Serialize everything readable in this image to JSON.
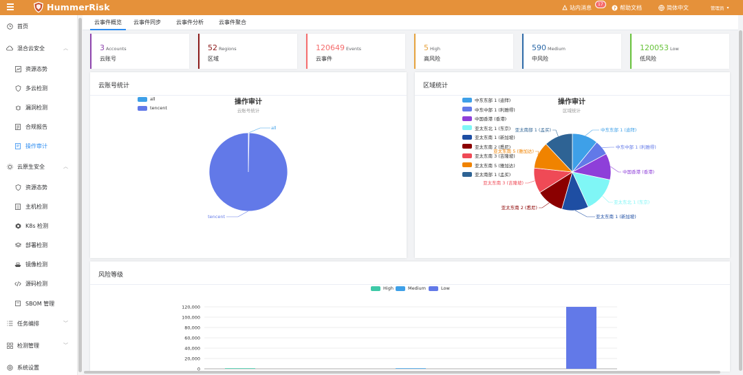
{
  "app": {
    "name": "HummerRisk",
    "brand_color": "#e5913a",
    "accent": "#2d8cf0"
  },
  "topbar": {
    "messages": "站内消息",
    "message_count": "17",
    "help": "帮助文档",
    "language": "简体中文",
    "user": "管理员"
  },
  "sidebar": {
    "items": [
      {
        "label": "首页",
        "icon": "clock-icon"
      },
      {
        "label": "混合云安全",
        "icon": "cloud-icon",
        "expandable": true
      },
      {
        "label": "资源态势",
        "icon": "chart-icon"
      },
      {
        "label": "多云检测",
        "icon": "shield-icon"
      },
      {
        "label": "漏洞检测",
        "icon": "bug-icon"
      },
      {
        "label": "合规报告",
        "icon": "report-icon"
      },
      {
        "label": "操作审计",
        "icon": "audit-icon",
        "active": true
      },
      {
        "label": "云原生安全",
        "icon": "gear-icon",
        "expandable": true
      },
      {
        "label": "资源态势",
        "icon": "shield-icon"
      },
      {
        "label": "主机检测",
        "icon": "list-icon"
      },
      {
        "label": "K8s 检测",
        "icon": "k8s-icon"
      },
      {
        "label": "部署检测",
        "icon": "layers-icon"
      },
      {
        "label": "镜像检测",
        "icon": "ship-icon"
      },
      {
        "label": "源码检测",
        "icon": "code-icon"
      },
      {
        "label": "SBOM 管理",
        "icon": "box-icon"
      },
      {
        "label": "任务编排",
        "icon": "list-icon",
        "expandable": true
      },
      {
        "label": "检测管理",
        "icon": "grid-icon",
        "expandable": true
      },
      {
        "label": "系统设置",
        "icon": "settings-icon"
      }
    ]
  },
  "tabs": [
    {
      "label": "云事件概览",
      "active": true
    },
    {
      "label": "云事件同步"
    },
    {
      "label": "云事件分析"
    },
    {
      "label": "云事件聚合"
    }
  ],
  "stats": [
    {
      "value": "3",
      "unit": "Accounts",
      "label": "云账号",
      "color": "#8e44ad"
    },
    {
      "value": "52",
      "unit": "Regions",
      "label": "区域",
      "color": "#8b1a1a"
    },
    {
      "value": "120649",
      "unit": "Events",
      "label": "云事件",
      "color": "#f56c6c"
    },
    {
      "value": "5",
      "unit": "High",
      "label": "高风险",
      "color": "#e6a23c"
    },
    {
      "value": "590",
      "unit": "Medium",
      "label": "中风险",
      "color": "#2d6aa8"
    },
    {
      "value": "120053",
      "unit": "Low",
      "label": "低风险",
      "color": "#67c23a"
    }
  ],
  "account_chart": {
    "card_title": "云账号统计",
    "title": "操作审计",
    "subtitle": "云账号统计",
    "legend": [
      {
        "name": "all",
        "color": "#3ea0e8"
      },
      {
        "name": "tencent",
        "color": "#6279e8"
      }
    ],
    "chart_data": {
      "type": "pie",
      "labels": [
        "all",
        "tencent"
      ],
      "values": [
        0.3,
        99.7
      ],
      "colors": [
        "#3ea0e8",
        "#6279e8"
      ]
    }
  },
  "region_chart": {
    "card_title": "区域统计",
    "title": "操作审计",
    "subtitle": "区域统计",
    "legend": [
      {
        "name": "中东东部 1 (迪拜)",
        "color": "#3ea0e8"
      },
      {
        "name": "中东中部 1 (利雅得)",
        "color": "#6279e8"
      },
      {
        "name": "中国香港 (香港)",
        "color": "#8e3fd9"
      },
      {
        "name": "亚太东北 1 (东京)",
        "color": "#7ff6f6"
      },
      {
        "name": "亚太东南 1 (新加坡)",
        "color": "#1e4ea3"
      },
      {
        "name": "亚太东南 2 (悉尼)",
        "color": "#8b0000"
      },
      {
        "name": "亚太东南 3 (吉隆坡)",
        "color": "#ef4a56"
      },
      {
        "name": "亚太东南 5 (雅加达)",
        "color": "#f08300"
      },
      {
        "name": "亚太南部 1 (孟买)",
        "color": "#2e6394"
      }
    ],
    "chart_data": {
      "type": "pie",
      "labels": [
        "中东东部 1 (迪拜)",
        "中东中部 1 (利雅得)",
        "中国香港 (香港)",
        "亚太东北 1 (东京)",
        "亚太东南 1 (新加坡)",
        "亚太东南 2 (悉尼)",
        "亚太东南 3 (吉隆坡)",
        "亚太东南 5 (雅加达)",
        "亚太南部 1 (孟买)"
      ],
      "values": [
        10.8,
        6.2,
        11.0,
        14.8,
        11.1,
        11.5,
        10.5,
        11.2,
        11.9
      ],
      "colors": [
        "#3ea0e8",
        "#6279e8",
        "#8e3fd9",
        "#7ff6f6",
        "#1e4ea3",
        "#8b0000",
        "#ef4a56",
        "#f08300",
        "#2e6394"
      ]
    }
  },
  "risk_chart": {
    "card_title": "风险等级",
    "legend": [
      {
        "name": "High",
        "color": "#3ec9a7"
      },
      {
        "name": "Medium",
        "color": "#3ea0e8"
      },
      {
        "name": "Low",
        "color": "#6279e8"
      }
    ],
    "chart_data": {
      "type": "bar",
      "categories": [
        "High",
        "Medium",
        "Low"
      ],
      "series": [
        {
          "name": "High",
          "values": [
            5,
            0,
            0
          ]
        },
        {
          "name": "Medium",
          "values": [
            0,
            590,
            0
          ]
        },
        {
          "name": "Low",
          "values": [
            0,
            0,
            120053
          ]
        }
      ],
      "ylim": [
        0,
        120000
      ],
      "yticks": [
        "0",
        "20,000",
        "40,000",
        "60,000",
        "80,000",
        "100,000",
        "120,000"
      ]
    }
  }
}
